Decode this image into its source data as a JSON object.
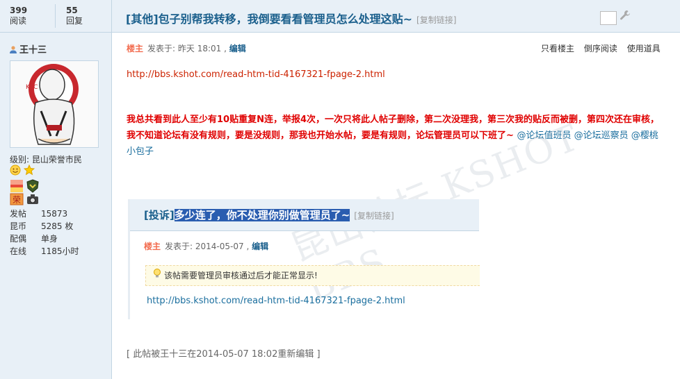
{
  "stats": {
    "views_value": "399",
    "views_label": "阅读",
    "replies_value": "55",
    "replies_label": "回复"
  },
  "thread": {
    "title": "[其他]包子别帮我转移，我倒要看看管理员怎么处理这贴~",
    "copy_link": "[复制链接]"
  },
  "author": {
    "name": "王十三",
    "level_label": "级别: 昆山荣誉市民",
    "info": [
      {
        "key": "发帖",
        "value": "15873"
      },
      {
        "key": "昆币",
        "value": "5285 枚"
      },
      {
        "key": "配偶",
        "value": "单身"
      },
      {
        "key": "在线",
        "value": "1185小时"
      }
    ]
  },
  "post": {
    "lz_label": "楼主",
    "posted": "发表于: 昨天 18:01",
    "edit": "编辑",
    "tools": [
      "只看楼主",
      "倒序阅读",
      "使用道具"
    ],
    "url": "http://bbs.kshot.com/read-htm-tid-4167321-fpage-2.html",
    "body": "我总共看到此人至少有10贴重复N连，举报4次，一次只将此人帖子删除，第二次没理我，第三次我的贴反而被删，第四次还在审核，我不知道论坛有没有规则，要是没规则，那我也开始水帖，要是有规则，论坛管理员可以下班了~",
    "mentions": "@论坛值班员 @论坛巡察员 @樱桃小包子",
    "edited_note": "[ 此帖被王十三在2014-05-07 18:02重新编辑 ]"
  },
  "quote": {
    "tag": "[投诉]",
    "title": "多少连了，你不处理你别做管理员了~",
    "copy_link": "[复制链接]",
    "lz_label": "楼主",
    "posted": "发表于: 2014-05-07",
    "edit": "编辑",
    "notice": "该帖需要管理员审核通过后才能正常显示!",
    "url": "http://bbs.kshot.com/read-htm-tid-4167321-fpage-2.html"
  },
  "watermark": "昆山论坛 KSHOT BBS",
  "colors": {
    "accent": "#1a5f8c",
    "header_bg": "#e8f0f7",
    "alert_red": "#e00000",
    "border": "#c2d5e3"
  },
  "icons": [
    "user-icon",
    "smile-icon",
    "star-icon",
    "flag-badge-icon",
    "shield-badge-icon",
    "fire-badge-icon",
    "camera-badge-icon",
    "wrench-icon",
    "bulb-icon"
  ]
}
